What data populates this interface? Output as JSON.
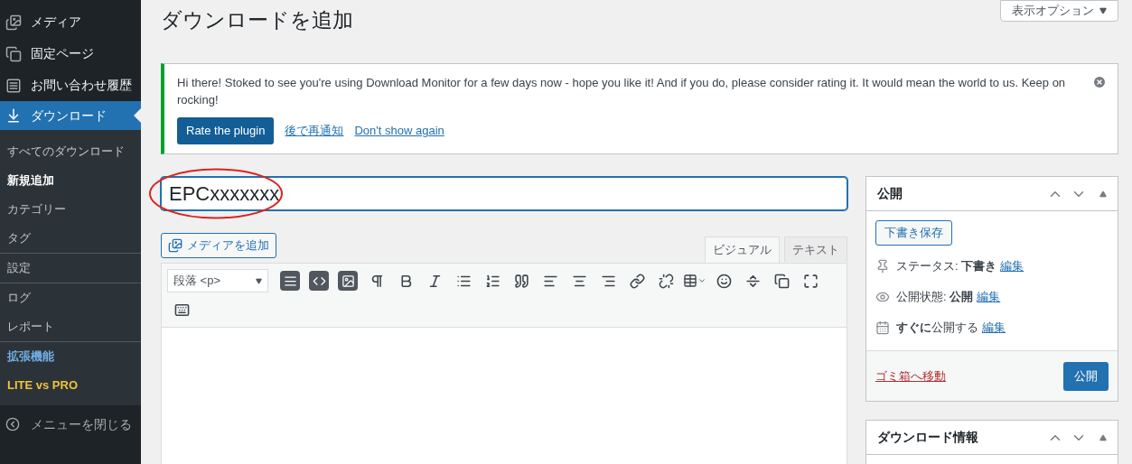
{
  "sidebar": {
    "menu": [
      {
        "label": "メディア",
        "selected": false
      },
      {
        "label": "固定ページ",
        "selected": false
      },
      {
        "label": "お問い合わせ履歴",
        "selected": false
      },
      {
        "label": "ダウンロード",
        "selected": true
      }
    ],
    "submenu": [
      [
        {
          "label": "すべてのダウンロード",
          "selected": false
        },
        {
          "label": "新規追加",
          "selected": true
        },
        {
          "label": "カテゴリー",
          "selected": false
        },
        {
          "label": "タグ",
          "selected": false
        }
      ],
      [
        {
          "label": "設定",
          "selected": false
        }
      ],
      [
        {
          "label": "ログ",
          "selected": false
        },
        {
          "label": "レポート",
          "selected": false
        }
      ],
      [
        {
          "label": "拡張機能",
          "selected": false,
          "color": "#72aee6"
        },
        {
          "label": "LITE vs PRO",
          "selected": false,
          "color": "#f0c33c"
        }
      ]
    ],
    "collapse": "メニューを閉じる"
  },
  "screen_options": "表示オプション",
  "title": "ダウンロードを追加",
  "notice": {
    "text": "Hi there! Stoked to see you're using Download Monitor for a few days now - hope you like it! And if you do, please consider rating it. It would mean the world to us. Keep on rocking!",
    "button": "Rate the plugin",
    "links": [
      "後で再通知",
      "Don't show again"
    ]
  },
  "post_title": {
    "value": "EPCxxxxxxx"
  },
  "editor": {
    "add_media": "メディアを追加",
    "tabs": [
      {
        "label": "ビジュアル",
        "selected": true
      },
      {
        "label": "テキスト",
        "selected": false
      }
    ],
    "format": "段落 <p>"
  },
  "publish_box": {
    "title": "公開",
    "save_draft": "下書き保存",
    "rows": [
      {
        "text": "ステータス: **下書き**",
        "link": "編集"
      },
      {
        "text": "公開状態: **公開**",
        "link": "編集"
      },
      {
        "text": "**すぐに**公開する",
        "link": "編集"
      }
    ],
    "trash": "ゴミ箱へ移動",
    "publish": "公開"
  },
  "info_box": {
    "title": "ダウンロード情報"
  }
}
